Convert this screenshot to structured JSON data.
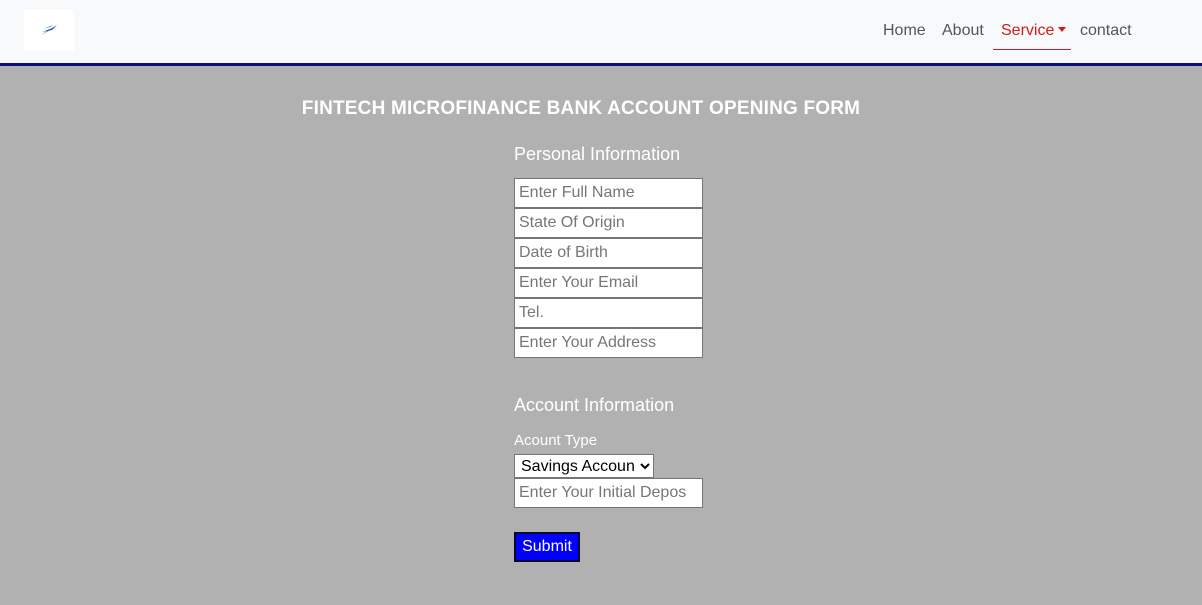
{
  "nav": {
    "links": [
      "Home",
      "About",
      "Service",
      "contact"
    ],
    "active_color": "#d01c1c"
  },
  "logo": {
    "icon": "logo-icon"
  },
  "form": {
    "title": "FINTECH MICROFINANCE BANK ACCOUNT OPENING FORM",
    "personal": {
      "heading": "Personal Information",
      "placeholders": [
        "Enter Full Name",
        "State Of Origin",
        "Date of Birth",
        "Enter Your Email",
        "Tel.",
        "Enter Your Address"
      ]
    },
    "account": {
      "heading": "Account Information",
      "type_label": "Acount Type",
      "type_selected": "Savings Account",
      "deposit_placeholder": "Enter Your Initial Depos"
    },
    "submit_label": "Submit",
    "submit_color": "#0000ff"
  }
}
